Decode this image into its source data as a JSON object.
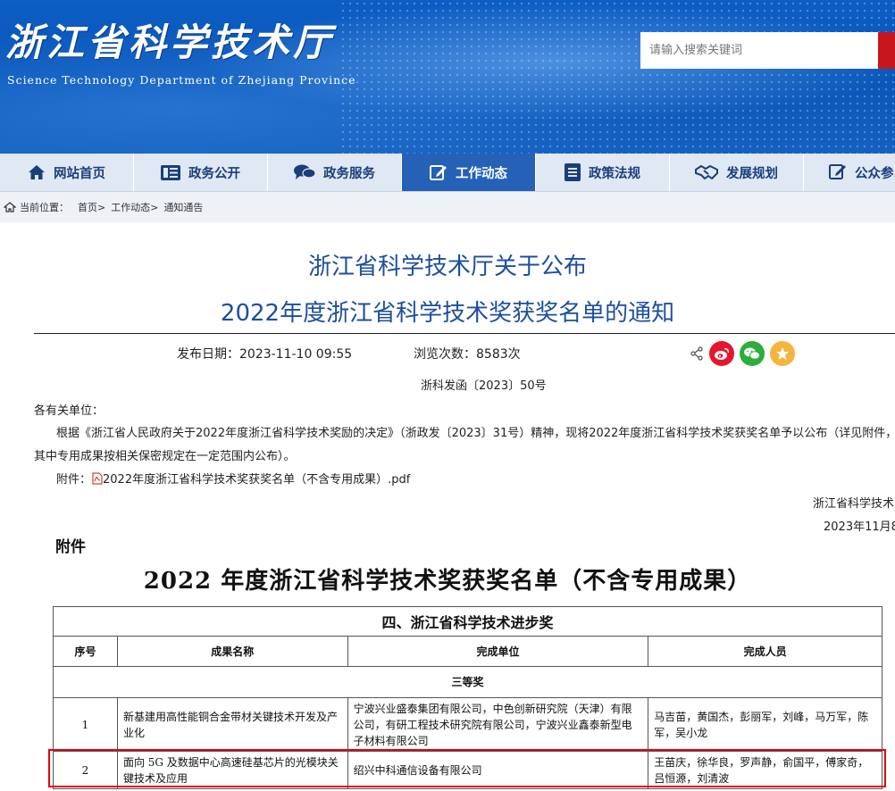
{
  "header": {
    "site_title": "浙江省科学技术厅",
    "site_subtitle": "Science Technology Department of Zhejiang Province",
    "search_placeholder": "请输入搜索关键词"
  },
  "nav": {
    "items": [
      {
        "label": "网站首页",
        "icon": "home-icon"
      },
      {
        "label": "政务公开",
        "icon": "list-icon"
      },
      {
        "label": "政务服务",
        "icon": "chat-icon"
      },
      {
        "label": "工作动态",
        "icon": "pencil-icon",
        "active": true
      },
      {
        "label": "政策法规",
        "icon": "document-icon"
      },
      {
        "label": "发展规划",
        "icon": "handshake-icon"
      },
      {
        "label": "公众参",
        "icon": "chat-edit-icon"
      }
    ]
  },
  "breadcrumb": {
    "prefix": "当前位置：",
    "items": [
      "首页>",
      "工作动态>",
      "通知通告"
    ]
  },
  "article": {
    "title_line1": "浙江省科学技术厅关于公布",
    "title_line2": "2022年度浙江省科学技术奖获奖名单的通知",
    "publish_label": "发布日期：",
    "publish_date": "2023-11-10 09:55",
    "views_label": "浏览次数：",
    "views": "8583次",
    "doc_number": "浙科发函〔2023〕50号",
    "salutation": "各有关单位：",
    "body_line1": "根据《浙江省人民政府关于2022年度浙江省科学技术奖励的决定》（浙政发〔2023〕31号）精神，现将2022年度浙江省科学技术奖获奖名单予以公布（详见附件，",
    "body_line2": "其中专用成果按相关保密规定在一定范围内公布）。",
    "attachment_label": "附件：",
    "attachment_file": "2022年度浙江省科学技术奖获奖名单（不含专用成果）.pdf",
    "signature": "浙江省科学技术",
    "sign_date": "2023年11月8"
  },
  "attachment_doc": {
    "label": "附件",
    "title": "2022 年度浙江省科学技术奖获奖名单（不含专用成果）",
    "table": {
      "caption": "四、浙江省科学技术进步奖",
      "headers": [
        "序号",
        "成果名称",
        "完成单位",
        "完成人员"
      ],
      "grade": "三等奖",
      "rows": [
        {
          "num": "1",
          "name": "新基建用高性能铜合金带材关键技术开发及产业化",
          "units": "宁波兴业盛泰集团有限公司，中色创新研究院（天津）有限公司，有研工程技术研究院有限公司，宁波兴业鑫泰新型电子材料有限公司",
          "people": "马吉苗，黄国杰，彭丽军，刘峰，马万军，陈军，吴小龙"
        },
        {
          "num": "2",
          "name": "面向 5G 及数据中心高速硅基芯片的光模块关键技术及应用",
          "units": "绍兴中科通信设备有限公司",
          "people": "王苗庆，徐华良，罗声静，俞国平，傅家奇，吕恒源，刘清波"
        }
      ]
    }
  },
  "colors": {
    "banner_blue": "#0a56b8",
    "nav_bg": "#dfe8f3",
    "nav_active": "#2561b6",
    "title_blue": "#1d4f9c",
    "search_button_red": "#c8161d",
    "highlight_red": "#e60012",
    "weibo_red": "#e6162d",
    "wechat_green": "#2bae3a",
    "star_yellow": "#f4b53f"
  }
}
